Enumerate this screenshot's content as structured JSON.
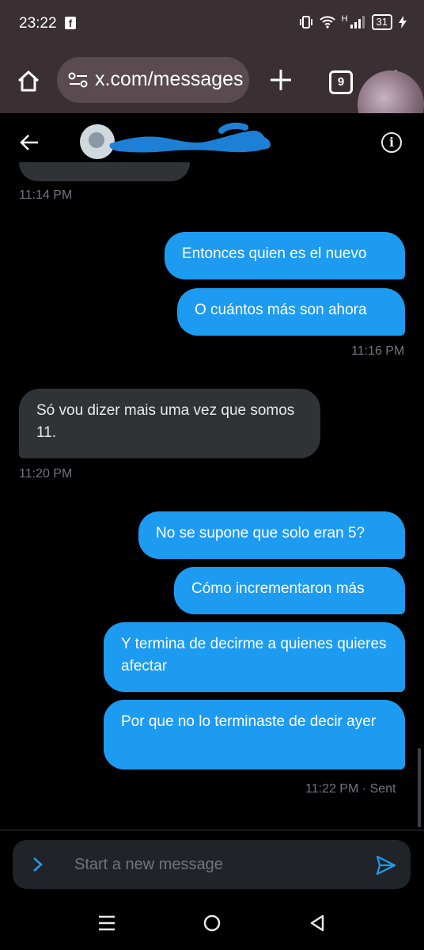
{
  "status_bar": {
    "time": "23:22",
    "network": "H",
    "battery": "31"
  },
  "browser": {
    "url": "x.com/messages",
    "tab_count": "9"
  },
  "colors": {
    "accent": "#1d9bf0",
    "incoming_bubble": "#2f3336",
    "timestamp": "#71767b",
    "browser_bar": "#3a2f33"
  },
  "icons": {
    "home": "home-icon",
    "site_settings": "tune-icon",
    "new_tab": "plus-icon",
    "tabs": "tabs-icon",
    "menu": "kebab-menu-icon",
    "back": "arrow-left-icon",
    "info": "info-icon",
    "expand": "chevron-right-icon",
    "send": "send-icon"
  },
  "messages": [
    {
      "direction": "out",
      "text": "Entonces quien es el nuevo"
    },
    {
      "direction": "out",
      "text": "O cuántos más son ahora"
    },
    {
      "direction": "in",
      "text": "Só vou dizer mais uma vez que somos 11."
    },
    {
      "direction": "out",
      "text": "No se supone que solo eran 5?"
    },
    {
      "direction": "out",
      "text": "Cómo incrementaron más"
    },
    {
      "direction": "out",
      "text": "Y termina de decirme a quienes quieres afectar"
    },
    {
      "direction": "out",
      "text": "Por que no lo terminaste de decir ayer"
    }
  ],
  "timestamps": [
    "11:14 PM",
    "11:16 PM",
    "11:20 PM",
    "11:22 PM · Sent"
  ],
  "composer": {
    "placeholder": "Start a new message"
  }
}
